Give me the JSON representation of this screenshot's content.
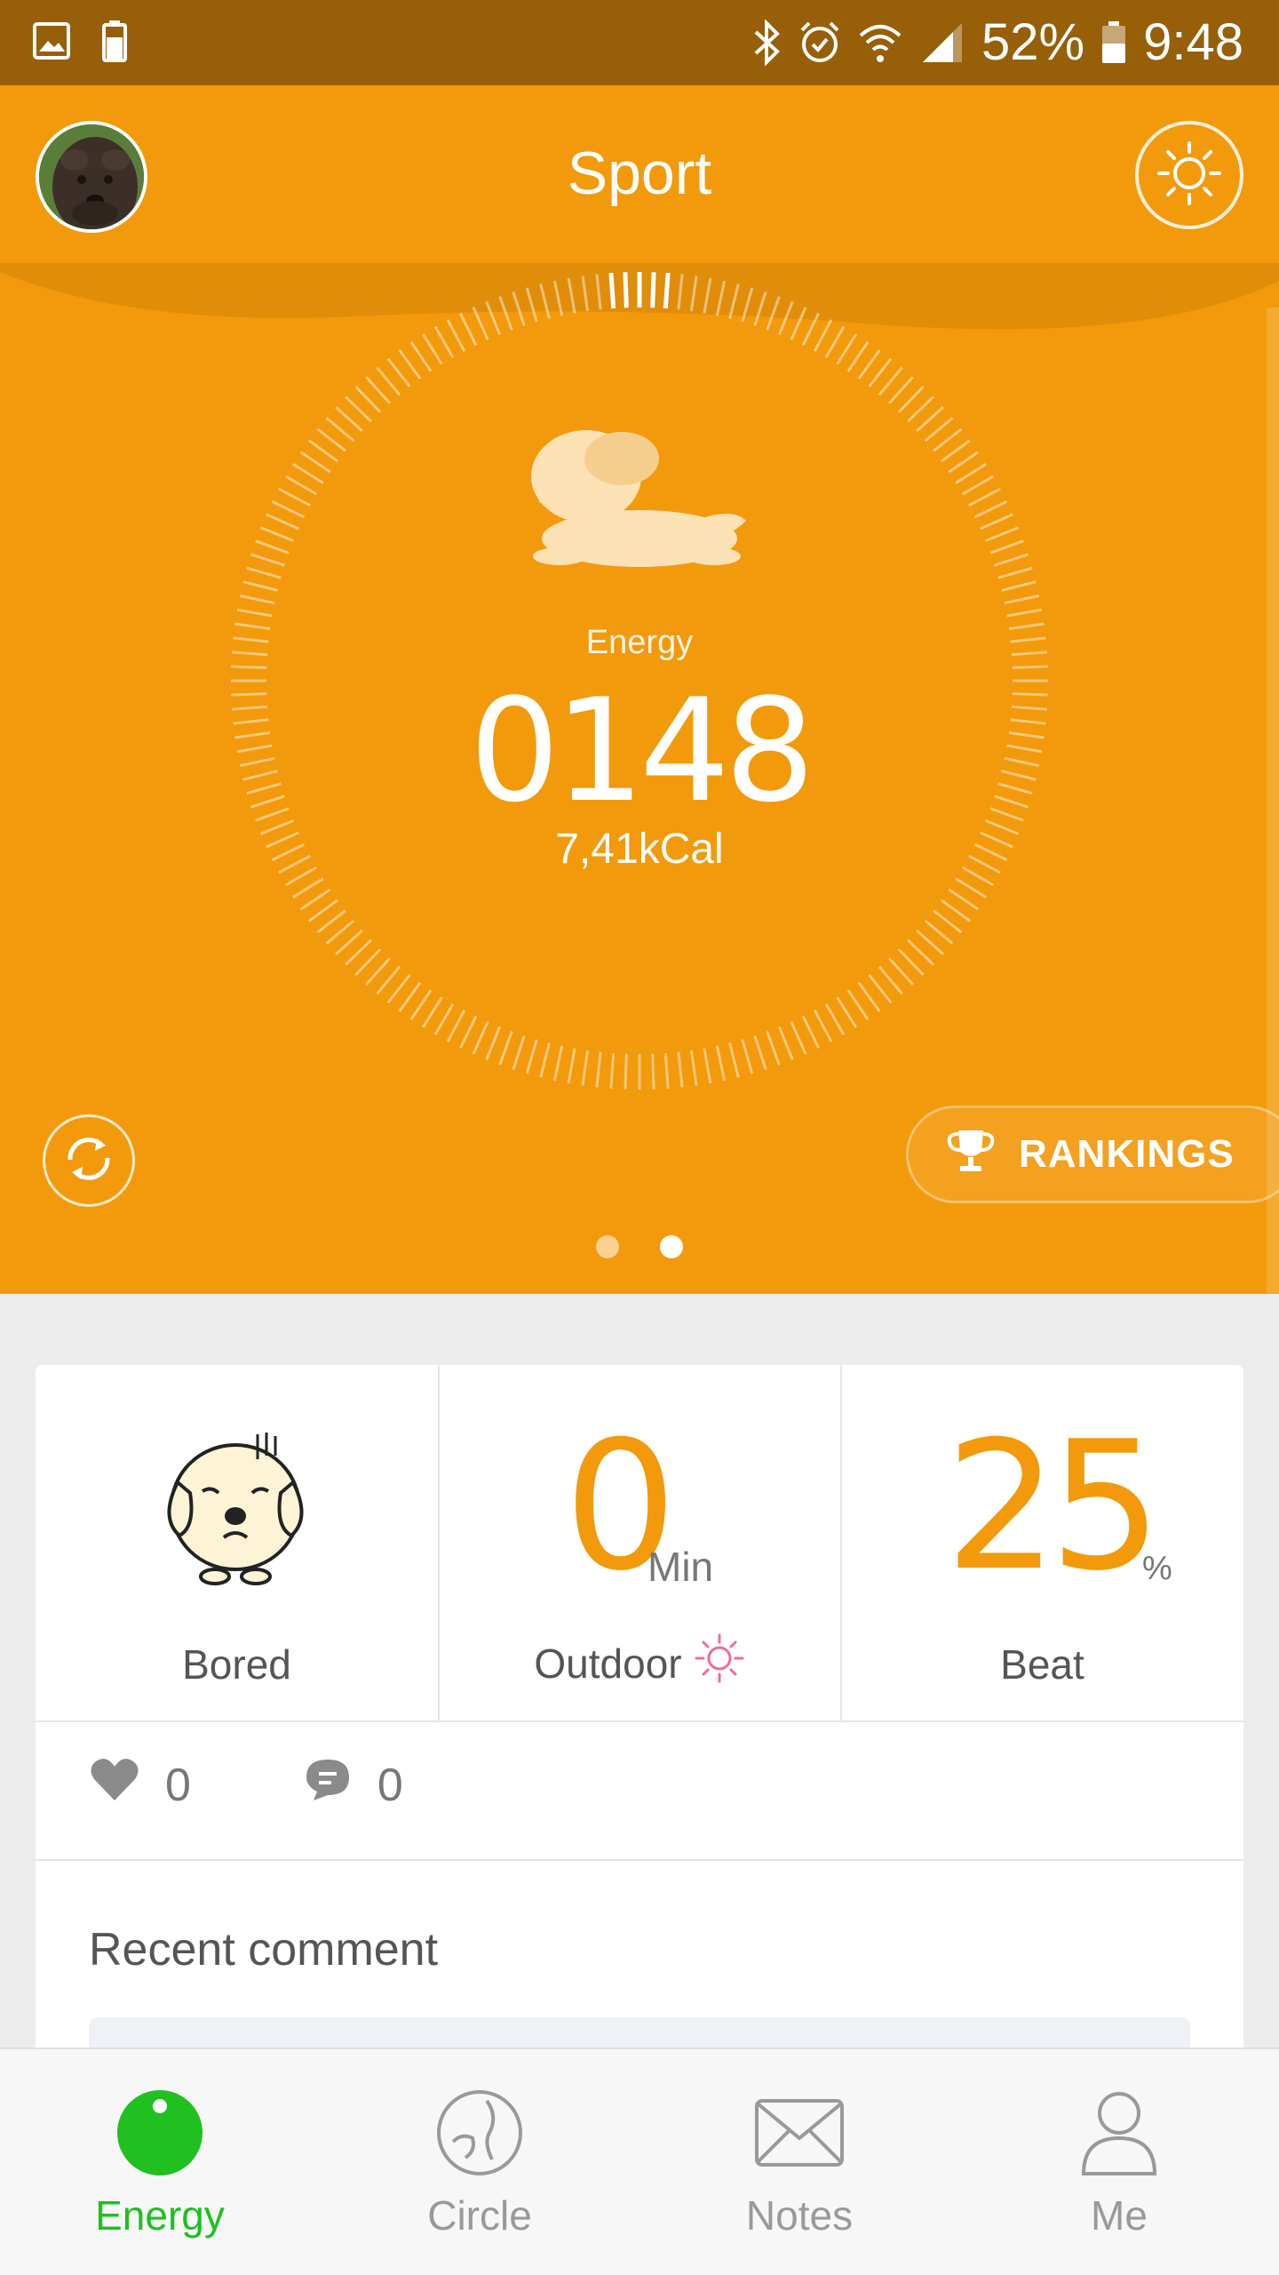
{
  "status_bar": {
    "battery_percent": "52%",
    "time": "9:48",
    "left_icons": [
      "gallery-icon",
      "battery-small-icon"
    ],
    "right_icons": [
      "bluetooth-icon",
      "alarm-icon",
      "wifi-icon",
      "signal-icon",
      "battery-icon"
    ]
  },
  "header": {
    "title": "Sport",
    "avatar_icon": "dog-avatar",
    "right_icon": "sun-icon"
  },
  "hero": {
    "label": "Energy",
    "value": "0148",
    "kcal": "7,41kCal",
    "rankings_label": "RANKINGS",
    "refresh_icon": "refresh-icon",
    "page_count": 2,
    "active_page": 2
  },
  "stats": {
    "mood_label": "Bored",
    "outdoor_value": "0",
    "outdoor_unit": "Min",
    "outdoor_label": "Outdoor",
    "beat_value": "25",
    "beat_unit": "%",
    "beat_label": "Beat"
  },
  "social": {
    "likes": "0",
    "comments": "0"
  },
  "recent_comment_label": "Recent comment",
  "nav": {
    "items": [
      {
        "label": "Energy",
        "icon": "energy-icon",
        "active": true
      },
      {
        "label": "Circle",
        "icon": "circle-icon",
        "active": false
      },
      {
        "label": "Notes",
        "icon": "envelope-icon",
        "active": false
      },
      {
        "label": "Me",
        "icon": "person-icon",
        "active": false
      }
    ]
  },
  "colors": {
    "primary_orange": "#f29a0b",
    "status_bar": "#975f08",
    "active_green": "#1fc01f",
    "outdoor_sun_pink": "#f06a9a"
  }
}
